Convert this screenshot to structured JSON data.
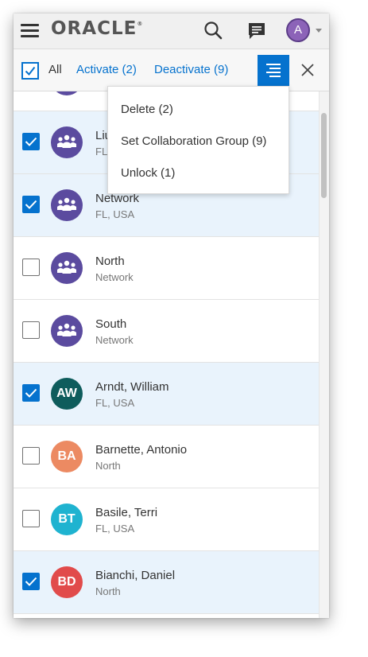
{
  "header": {
    "logo_text": "ORACLE",
    "logo_mark": "®",
    "avatar_initial": "A",
    "avatar_color": "#8c63b8",
    "icons": [
      "menu-icon",
      "search-icon",
      "chat-icon",
      "chevron-down-icon"
    ]
  },
  "actionbar": {
    "all_label": "All",
    "all_checked": true,
    "activate_label": "Activate (2)",
    "deactivate_label": "Deactivate (9)",
    "accent_color": "#0572ce",
    "icons": [
      "more-actions-icon",
      "close-icon"
    ]
  },
  "menu": {
    "items": [
      {
        "label": "Delete (2)"
      },
      {
        "label": "Set Collaboration Group (9)"
      },
      {
        "label": "Unlock (1)"
      }
    ]
  },
  "list": {
    "rows": [
      {
        "title": "",
        "subtitle": "",
        "checked": false,
        "type": "group"
      },
      {
        "title": "Liu",
        "subtitle": "FL",
        "checked": true,
        "type": "group"
      },
      {
        "title": "Network",
        "subtitle": "FL, USA",
        "checked": true,
        "type": "group"
      },
      {
        "title": "North",
        "subtitle": "Network",
        "checked": false,
        "type": "group"
      },
      {
        "title": "South",
        "subtitle": "Network",
        "checked": false,
        "type": "group"
      },
      {
        "title": "Arndt, William",
        "subtitle": "FL, USA",
        "checked": true,
        "type": "person",
        "initials": "AW",
        "color": "#0e5c5c"
      },
      {
        "title": "Barnette, Antonio",
        "subtitle": "North",
        "checked": false,
        "type": "person",
        "initials": "BA",
        "color": "#ec8a62"
      },
      {
        "title": "Basile, Terri",
        "subtitle": "FL, USA",
        "checked": false,
        "type": "person",
        "initials": "BT",
        "color": "#1fb3d0"
      },
      {
        "title": "Bianchi, Daniel",
        "subtitle": "North",
        "checked": true,
        "type": "person",
        "initials": "BD",
        "color": "#e14b4b"
      }
    ]
  }
}
